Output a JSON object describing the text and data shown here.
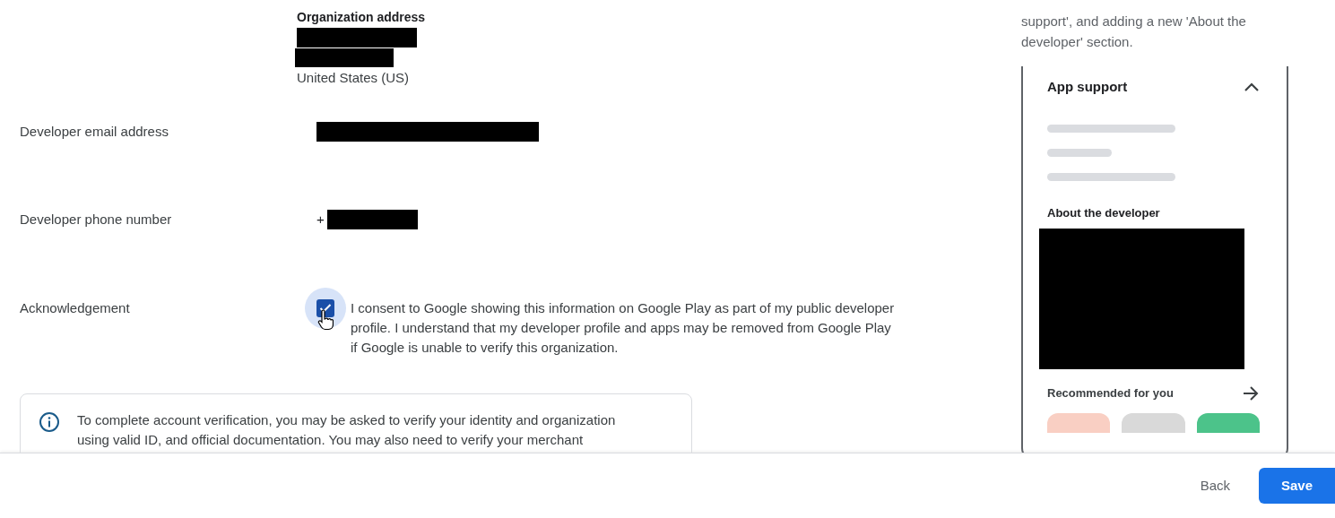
{
  "organization_address": {
    "label": "Organization address",
    "country": "United States (US)"
  },
  "fields": [
    {
      "label": "Developer email address"
    },
    {
      "label": "Developer phone number",
      "prefix": "+"
    }
  ],
  "acknowledgement": {
    "label": "Acknowledgement",
    "checked": true,
    "text": "I consent to Google showing this information on Google Play as part of my public developer profile. I understand that my developer profile and apps may be removed from Google Play if Google is unable to verify this organization."
  },
  "info_notice": "To complete account verification, you may be asked to verify your identity and organization using valid ID, and official documentation. You may also need to verify your merchant",
  "preview": {
    "description": "support', and adding a new 'About the developer' section.",
    "section_title": "App support",
    "expanded": true,
    "about_title": "About the developer",
    "recommended_title": "Recommended for you",
    "tiles": [
      {
        "color": "#f9cfc3"
      },
      {
        "color": "#d9d9d9"
      },
      {
        "color": "#4cc38a"
      }
    ]
  },
  "footer": {
    "back": "Back",
    "save": "Save"
  }
}
